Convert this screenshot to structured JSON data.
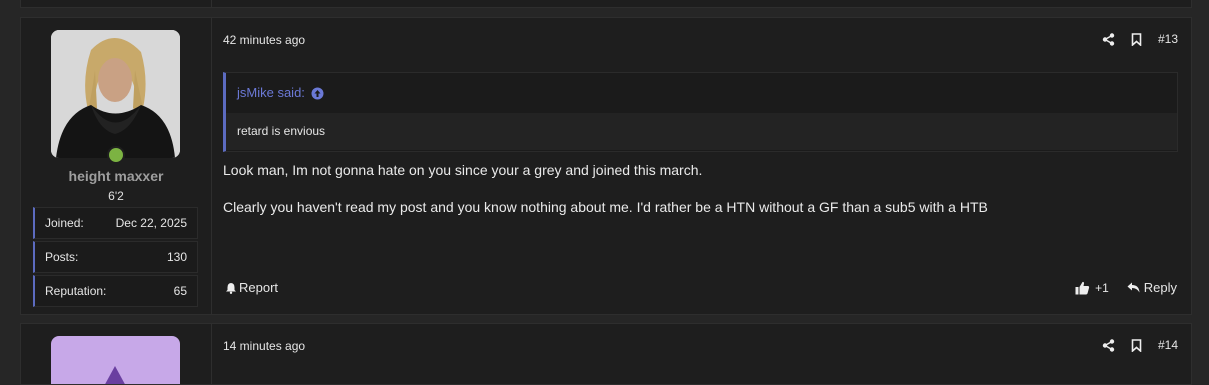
{
  "colors": {
    "accent": "#5c6bc0",
    "online": "#7cb342",
    "username": "#9e9e9e",
    "quote_author": "#6b79d6",
    "avatar_placeholder": "#c7a8e8"
  },
  "post13": {
    "timestamp": "42 minutes ago",
    "number": "#13",
    "author": {
      "name": "height maxxer",
      "title": "6'2",
      "online": true,
      "stats": [
        {
          "key": "Joined:",
          "value": "Dec 22, 2025"
        },
        {
          "key": "Posts:",
          "value": "130"
        },
        {
          "key": "Reputation:",
          "value": "65"
        }
      ]
    },
    "quote": {
      "author": "jsMike said:",
      "text": "retard is envious"
    },
    "message": [
      "Look man, Im not gonna hate on you since your a grey and joined this march.",
      "Clearly you haven't read my post and you know nothing about me. I'd rather be a HTN without a GF than a sub5 with a HTB"
    ],
    "report_label": "Report",
    "like_count": "+1",
    "reply_label": "Reply"
  },
  "post14": {
    "timestamp": "14 minutes ago",
    "number": "#14"
  },
  "icons": {
    "share": "share-icon",
    "bookmark": "bookmark-icon",
    "bell": "bell-icon",
    "thumbs_up": "thumbs-up-icon",
    "reply": "reply-arrow-icon",
    "quote_link": "arrow-up-circle-icon"
  }
}
